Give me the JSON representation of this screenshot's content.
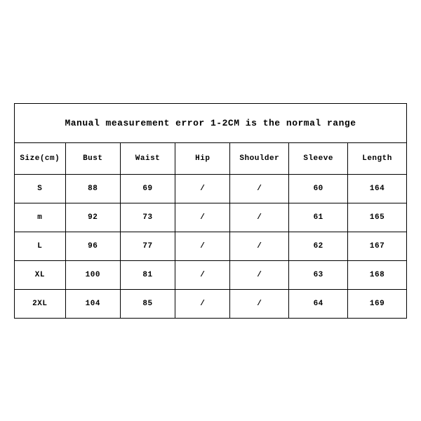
{
  "chart_data": {
    "type": "table",
    "title": "Manual measurement error 1-2CM is the normal range",
    "columns": [
      "Size(cm)",
      "Bust",
      "Waist",
      "Hip",
      "Shoulder",
      "Sleeve",
      "Length"
    ],
    "rows": [
      {
        "size": "S",
        "bust": "88",
        "waist": "69",
        "hip": "/",
        "shoulder": "/",
        "sleeve": "60",
        "length": "164"
      },
      {
        "size": "m",
        "bust": "92",
        "waist": "73",
        "hip": "/",
        "shoulder": "/",
        "sleeve": "61",
        "length": "165"
      },
      {
        "size": "L",
        "bust": "96",
        "waist": "77",
        "hip": "/",
        "shoulder": "/",
        "sleeve": "62",
        "length": "167"
      },
      {
        "size": "XL",
        "bust": "100",
        "waist": "81",
        "hip": "/",
        "shoulder": "/",
        "sleeve": "63",
        "length": "168"
      },
      {
        "size": "2XL",
        "bust": "104",
        "waist": "85",
        "hip": "/",
        "shoulder": "/",
        "sleeve": "64",
        "length": "169"
      }
    ]
  }
}
